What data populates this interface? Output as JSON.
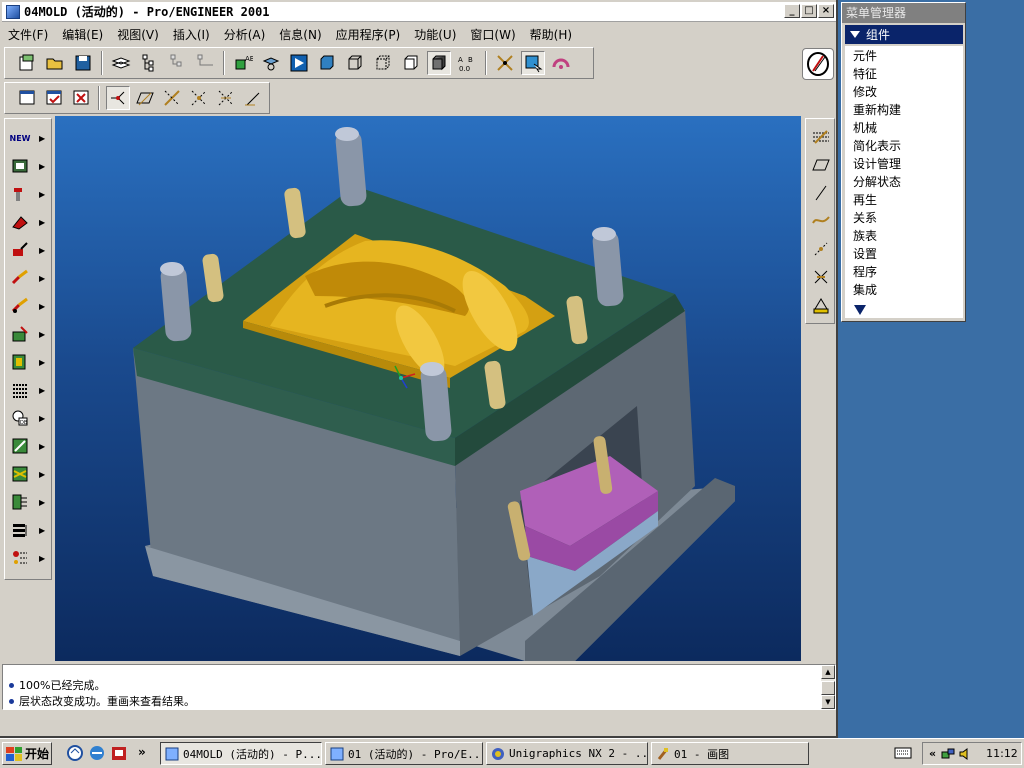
{
  "window": {
    "title": "04MOLD (活动的) - Pro/ENGINEER 2001",
    "controls": {
      "minimize": "_",
      "maximize": "□",
      "close": "×"
    }
  },
  "menubar": {
    "items": [
      "文件(F)",
      "编辑(E)",
      "视图(V)",
      "插入(I)",
      "分析(A)",
      "信息(N)",
      "应用程序(P)",
      "功能(U)",
      "窗口(W)",
      "帮助(H)"
    ]
  },
  "left_toolbar": {
    "new_label": "NEW"
  },
  "messages": [
    "100%已经完成。",
    "层状态改变成功。重画来查看结果。"
  ],
  "menu_manager": {
    "title": "菜单管理器",
    "header": "组件",
    "items": [
      "元件",
      "特征",
      "修改",
      "重新构建",
      "机械",
      "简化表示",
      "设计管理",
      "分解状态",
      "再生",
      "关系",
      "族表",
      "设置",
      "程序",
      "集成"
    ]
  },
  "taskbar": {
    "start_label": "开始",
    "quicklaunch_more": "»",
    "tasks": [
      "04MOLD (活动的) - P...",
      "01 (活动的) - Pro/E...",
      "Unigraphics NX 2 - ...",
      "01 - 画图"
    ],
    "tray_more": "«",
    "clock": "11:12"
  },
  "colors": {
    "mold_plate": "#2f5e4e",
    "mold_body": "#6c7884",
    "core": "#d4a012",
    "ejector_plate": "#b060b8",
    "viewport_top": "#2a70c0",
    "viewport_bottom": "#0c2a5e",
    "menu_highlight": "#0a246a",
    "desktop": "#3a6ea5"
  }
}
